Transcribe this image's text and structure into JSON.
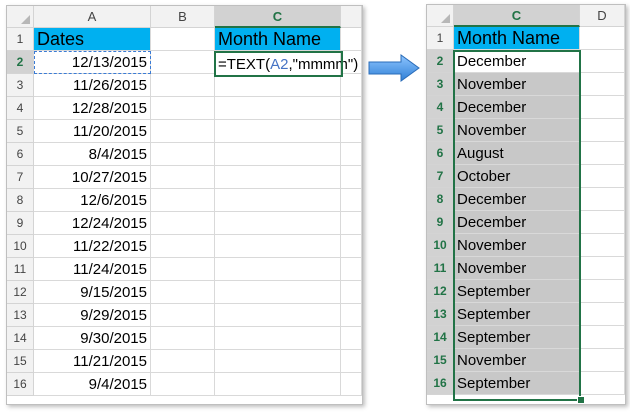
{
  "left_sheet": {
    "columns": [
      "A",
      "B",
      "C"
    ],
    "rows": [
      "1",
      "2",
      "3",
      "4",
      "5",
      "6",
      "7",
      "8",
      "9",
      "10",
      "11",
      "12",
      "13",
      "14",
      "15",
      "16"
    ],
    "header_a": "Dates",
    "header_c": "Month Name",
    "dates": [
      "12/13/2015",
      "11/26/2015",
      "12/28/2015",
      "11/20/2015",
      "8/4/2015",
      "10/27/2015",
      "12/6/2015",
      "12/24/2015",
      "11/22/2015",
      "11/24/2015",
      "9/15/2015",
      "9/29/2015",
      "9/30/2015",
      "11/21/2015",
      "9/4/2015"
    ],
    "formula": {
      "prefix": "=TEXT(",
      "ref": "A2",
      "suffix": ",\"mmmm\")"
    }
  },
  "right_sheet": {
    "columns": [
      "C",
      "D"
    ],
    "rows": [
      "1",
      "2",
      "3",
      "4",
      "5",
      "6",
      "7",
      "8",
      "9",
      "10",
      "11",
      "12",
      "13",
      "14",
      "15",
      "16"
    ],
    "header_c": "Month Name",
    "months": [
      "December",
      "November",
      "December",
      "November",
      "August",
      "October",
      "December",
      "December",
      "November",
      "November",
      "September",
      "September",
      "September",
      "November",
      "September"
    ]
  },
  "colors": {
    "header_fill": "#00b0f0",
    "selection": "#217346",
    "arrow": "#4a90e2",
    "formula_ref": "#4472c4",
    "result_fill": "#c8c8c8"
  },
  "icons": {
    "arrow": "right-arrow-icon"
  }
}
